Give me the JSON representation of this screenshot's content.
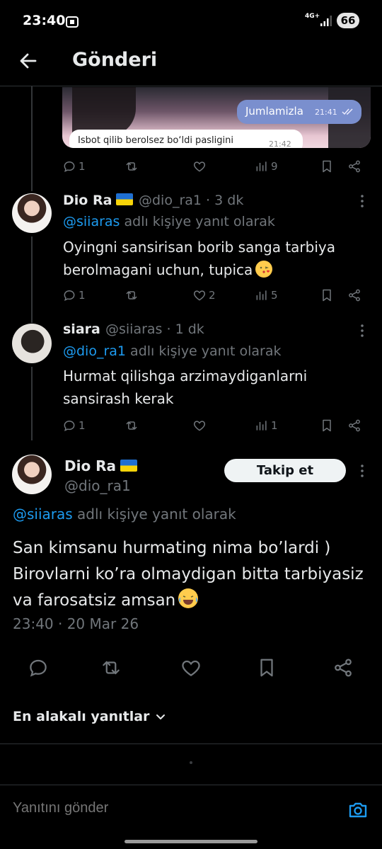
{
  "status_bar": {
    "time": "23:40",
    "network": "4G+",
    "battery": "66"
  },
  "header": {
    "title": "Gönderi"
  },
  "quoted_media": {
    "outgoing_text": "Jumlamizla",
    "outgoing_time": "21:41",
    "incoming_text": "Isbot qilib berolsez bo‘ldi pasligini",
    "incoming_time": "21:42"
  },
  "post0_actions": {
    "replies": "1",
    "reposts": "",
    "likes": "",
    "views": "9"
  },
  "reply1": {
    "name": "Dio Ra",
    "handle": "@dio_ra1 · 3 dk",
    "mention": "@siiaras",
    "context": " adlı kişiye yanıt olarak",
    "text": "Oyingni sansirisan borib sanga tarbiya berolmagani uchun, tupica",
    "actions": {
      "replies": "1",
      "reposts": "",
      "likes": "2",
      "views": "5"
    }
  },
  "reply2": {
    "name": "siara",
    "handle": "@siiaras · 1 dk",
    "mention": "@dio_ra1",
    "context": " adlı kişiye yanıt olarak",
    "text": "Hurmat qilishga arzimaydiganlarni sansirash kerak",
    "actions": {
      "replies": "1",
      "reposts": "",
      "likes": "",
      "views": "1"
    }
  },
  "main_post": {
    "name": "Dio Ra",
    "handle": "@dio_ra1",
    "follow_label": "Takip et",
    "mention": "@siiaras",
    "context": " adlı kişiye yanıt olarak",
    "text": "San kimsanu hurmating nima bo’lardi ) Birovlarni ko’ra olmaydigan bitta tarbiyasiz va farosatsiz amsan",
    "meta": "23:40 · 20 Mar 26"
  },
  "sort": {
    "label": "En alakalı yanıtlar"
  },
  "compose": {
    "placeholder": "Yanıtını gönder"
  },
  "colors": {
    "accent": "#1d9bf0",
    "muted": "#71767b",
    "text": "#e7e9ea",
    "background": "#000000"
  }
}
